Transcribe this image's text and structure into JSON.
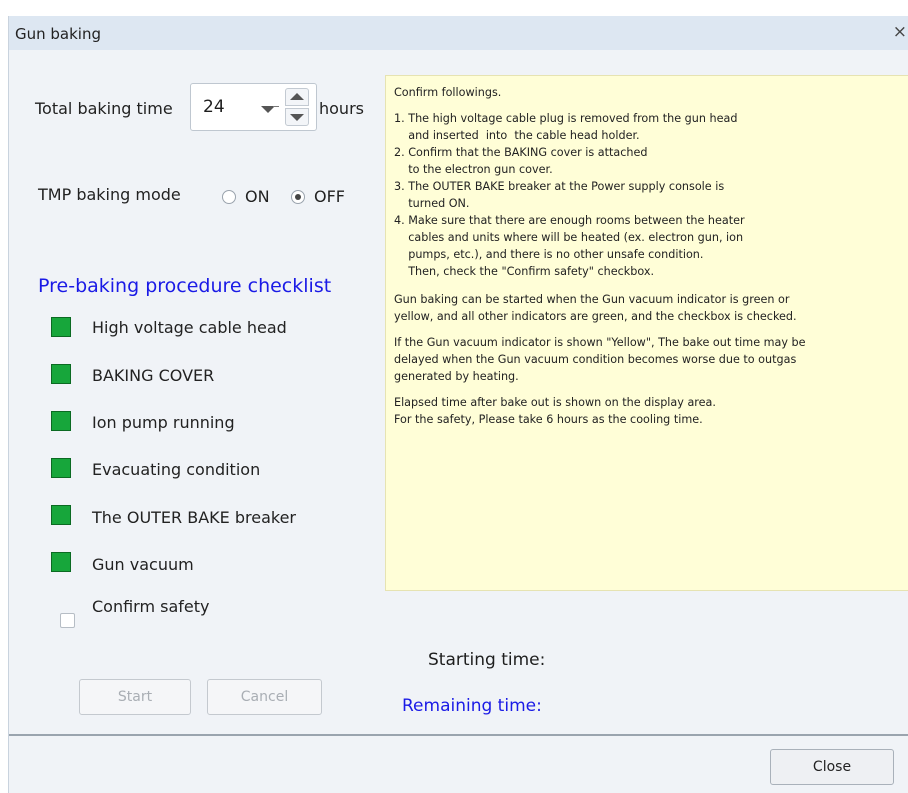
{
  "window": {
    "title": "Gun baking",
    "close_glyph": "×"
  },
  "baking_time": {
    "label": "Total baking time",
    "value": "24",
    "unit": "hours"
  },
  "tmp_mode": {
    "label": "TMP baking mode",
    "options": [
      {
        "label": "ON",
        "checked": false
      },
      {
        "label": "OFF",
        "checked": true
      }
    ]
  },
  "checklist": {
    "title": "Pre-baking procedure checklist",
    "title_color": "#1a1ae6",
    "indicator_color": "#17a63b",
    "items": [
      {
        "label": "High voltage cable head"
      },
      {
        "label": "BAKING COVER"
      },
      {
        "label": "Ion pump running"
      },
      {
        "label": "Evacuating condition"
      },
      {
        "label": "The OUTER BAKE breaker"
      },
      {
        "label": "Gun vacuum"
      }
    ],
    "confirm": {
      "label": "Confirm safety",
      "checked": false
    }
  },
  "info": {
    "heading": "Confirm followings.",
    "steps": "1. The high voltage cable plug is removed from the gun head\n    and inserted  into  the cable head holder.\n2. Confirm that the BAKING cover is attached\n    to the electron gun cover.\n3. The OUTER BAKE breaker at the Power supply console is\n    turned ON.\n4. Make sure that there are enough rooms between the heater\n    cables and units where will be heated (ex. electron gun, ion\n    pumps, etc.), and there is no other unsafe condition.\n    Then, check the \"Confirm safety\" checkbox.",
    "para1": "Gun baking can be started when the Gun vacuum indicator is green or\nyellow, and all other indicators are green, and the checkbox is checked.",
    "para2": "If the Gun vacuum indicator is shown \"Yellow\", The bake out time may be\ndelayed when the Gun vacuum condition becomes worse due to outgas\ngenerated by heating.",
    "para3": "Elapsed time after bake out is shown on the display area.\nFor the safety, Please take 6 hours as the cooling time.",
    "background": "#fffed7"
  },
  "times": {
    "starting_label": "Starting time:",
    "remaining_label": "Remaining time:",
    "remaining_color": "#1a1ae6"
  },
  "buttons": {
    "start": "Start",
    "cancel": "Cancel",
    "close": "Close"
  }
}
